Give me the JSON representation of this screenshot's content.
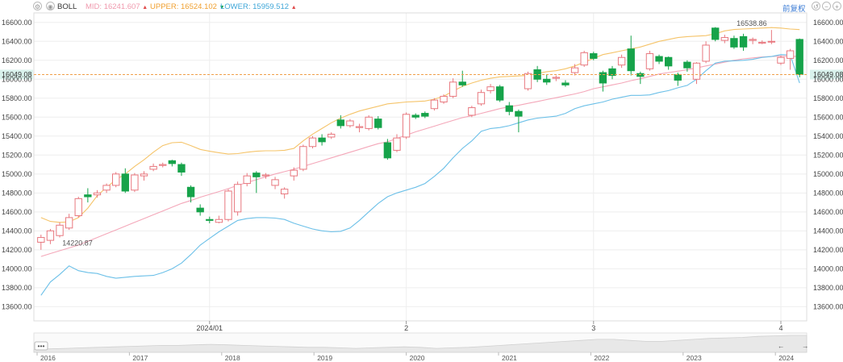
{
  "toolbar": {
    "indicator_name": "BOLL",
    "mid_label": "MID:",
    "mid_value": "16241.607",
    "mid_arrow": "▲",
    "upper_label": "UPPER:",
    "upper_value": "16524.102",
    "upper_arrow": "▼",
    "lower_label": "LOWER:",
    "lower_value": "15959.512",
    "lower_arrow": "▲",
    "adjust_label": "前复权"
  },
  "colors": {
    "mid": "#f4a7b9",
    "upper": "#f5c46a",
    "lower": "#6cc0e8",
    "up_candle": "#e8787f",
    "down_candle": "#16a34a",
    "current_price": "#f0a04b",
    "current_price_tag": "#d9f2ec"
  },
  "icons": [
    "gear-icon",
    "eye-icon",
    "undo-icon",
    "minus-icon",
    "plus-icon",
    "reset-icon"
  ],
  "chart_data": {
    "type": "candlestick",
    "indicator": "BOLL",
    "ylim": [
      13450,
      16700
    ],
    "yticks": [
      13600,
      13800,
      14000,
      14200,
      14400,
      14600,
      14800,
      15000,
      15200,
      15400,
      15600,
      15800,
      16000,
      16200,
      16400,
      16600
    ],
    "ytick_labels": [
      "13600.00",
      "13800.00",
      "14000.00",
      "14200.00",
      "14400.00",
      "14600.00",
      "14800.00",
      "15000.00",
      "15200.00",
      "15400.00",
      "15600.00",
      "15800.00",
      "16000.00",
      "16200.00",
      "16400.00",
      "16600.00"
    ],
    "xtick_labels": [
      {
        "label": "2024/01",
        "index": 18
      },
      {
        "label": "2",
        "index": 39
      },
      {
        "label": "3",
        "index": 59
      },
      {
        "label": "4",
        "index": 79
      }
    ],
    "current_price": 16049.08,
    "current_price_label": "16049.08",
    "annotations": [
      {
        "text": "16538.86",
        "index": 74,
        "value": 16538.86
      },
      {
        "text": "14220.87",
        "index": 2,
        "value": 14220.87
      }
    ],
    "candles": [
      [
        14280,
        14330,
        14200,
        14360
      ],
      [
        14300,
        14400,
        14260,
        14420
      ],
      [
        14350,
        14460,
        14330,
        14490
      ],
      [
        14430,
        14540,
        14410,
        14580
      ],
      [
        14560,
        14740,
        14540,
        14760
      ],
      [
        14780,
        14760,
        14700,
        14850
      ],
      [
        14780,
        14800,
        14750,
        14830
      ],
      [
        14830,
        14880,
        14800,
        14900
      ],
      [
        14880,
        15000,
        14860,
        15020
      ],
      [
        15000,
        14820,
        14800,
        15060
      ],
      [
        14830,
        14990,
        14810,
        15010
      ],
      [
        14980,
        15000,
        14930,
        15030
      ],
      [
        15050,
        15080,
        15030,
        15110
      ],
      [
        15090,
        15100,
        15070,
        15120
      ],
      [
        15140,
        15110,
        15080,
        15150
      ],
      [
        15100,
        15020,
        14980,
        15120
      ],
      [
        14860,
        14760,
        14700,
        14880
      ],
      [
        14640,
        14600,
        14560,
        14680
      ],
      [
        14520,
        14510,
        14480,
        14550
      ],
      [
        14490,
        14520,
        14480,
        14560
      ],
      [
        14520,
        14820,
        14500,
        14840
      ],
      [
        14600,
        14890,
        14560,
        14920
      ],
      [
        14900,
        14980,
        14870,
        15010
      ],
      [
        15010,
        14970,
        14800,
        15030
      ],
      [
        14980,
        14990,
        14950,
        15010
      ],
      [
        14880,
        14940,
        14840,
        14970
      ],
      [
        14790,
        14840,
        14740,
        14860
      ],
      [
        14980,
        15040,
        14930,
        15070
      ],
      [
        15050,
        15290,
        15030,
        15310
      ],
      [
        15290,
        15380,
        15270,
        15400
      ],
      [
        15380,
        15340,
        15300,
        15420
      ],
      [
        15390,
        15420,
        15370,
        15440
      ],
      [
        15570,
        15510,
        15480,
        15620
      ],
      [
        15510,
        15560,
        15490,
        15580
      ],
      [
        15490,
        15500,
        15440,
        15530
      ],
      [
        15480,
        15600,
        15460,
        15620
      ],
      [
        15580,
        15490,
        15470,
        15610
      ],
      [
        15330,
        15170,
        15150,
        15370
      ],
      [
        15250,
        15380,
        15230,
        15420
      ],
      [
        15390,
        15630,
        15370,
        15650
      ],
      [
        15620,
        15600,
        15580,
        15640
      ],
      [
        15640,
        15610,
        15590,
        15660
      ],
      [
        15690,
        15780,
        15670,
        15800
      ],
      [
        15760,
        15820,
        15740,
        15840
      ],
      [
        15820,
        15970,
        15800,
        16010
      ],
      [
        15970,
        15940,
        15920,
        16090
      ],
      [
        15620,
        15700,
        15600,
        15720
      ],
      [
        15740,
        15860,
        15720,
        15890
      ],
      [
        15880,
        15920,
        15850,
        15950
      ],
      [
        15920,
        15780,
        15760,
        15940
      ],
      [
        15720,
        15660,
        15620,
        15760
      ],
      [
        15660,
        15610,
        15440,
        15680
      ],
      [
        15900,
        16060,
        15880,
        16080
      ],
      [
        16100,
        16000,
        15970,
        16140
      ],
      [
        16000,
        15970,
        15940,
        16050
      ],
      [
        16010,
        16020,
        15980,
        16040
      ],
      [
        15960,
        15940,
        15920,
        15990
      ],
      [
        16070,
        16120,
        16040,
        16160
      ],
      [
        16150,
        16280,
        16130,
        16300
      ],
      [
        16270,
        16220,
        16200,
        16290
      ],
      [
        16070,
        15960,
        15870,
        16090
      ],
      [
        16110,
        16040,
        16000,
        16140
      ],
      [
        16150,
        16230,
        16120,
        16260
      ],
      [
        16320,
        16090,
        16040,
        16460
      ],
      [
        16060,
        16030,
        15950,
        16080
      ],
      [
        16110,
        16270,
        16090,
        16300
      ],
      [
        16240,
        16190,
        16160,
        16260
      ],
      [
        16230,
        16140,
        16100,
        16240
      ],
      [
        16050,
        15990,
        15930,
        16070
      ],
      [
        16180,
        16120,
        16080,
        16200
      ],
      [
        16000,
        16170,
        15950,
        16180
      ],
      [
        16190,
        16360,
        16170,
        16400
      ],
      [
        16540,
        16420,
        16400,
        16550
      ],
      [
        16410,
        16440,
        16380,
        16470
      ],
      [
        16430,
        16340,
        16320,
        16460
      ],
      [
        16450,
        16340,
        16300,
        16480
      ],
      [
        16410,
        16420,
        16370,
        16440
      ],
      [
        16380,
        16390,
        16370,
        16410
      ],
      [
        16400,
        16400,
        16370,
        16520
      ],
      [
        16170,
        16230,
        16150,
        16250
      ],
      [
        16220,
        16300,
        16100,
        16320
      ],
      [
        16420,
        16050,
        16020,
        16430
      ]
    ],
    "boll_upper": [
      14540,
      14500,
      14490,
      14495,
      14540,
      14640,
      14770,
      14860,
      14940,
      15000,
      15080,
      15150,
      15230,
      15300,
      15330,
      15335,
      15300,
      15260,
      15240,
      15225,
      15210,
      15215,
      15230,
      15240,
      15245,
      15245,
      15250,
      15270,
      15350,
      15420,
      15480,
      15540,
      15590,
      15630,
      15665,
      15690,
      15715,
      15740,
      15750,
      15760,
      15765,
      15770,
      15790,
      15820,
      15875,
      15925,
      15960,
      15990,
      16010,
      16025,
      16030,
      16035,
      16040,
      16060,
      16080,
      16090,
      16110,
      16140,
      16180,
      16220,
      16260,
      16280,
      16300,
      16320,
      16340,
      16370,
      16400,
      16420,
      16440,
      16450,
      16455,
      16460,
      16480,
      16510,
      16525,
      16530,
      16535,
      16540,
      16545,
      16540,
      16530,
      16524
    ],
    "boll_mid": [
      14130,
      14160,
      14190,
      14220,
      14250,
      14290,
      14330,
      14370,
      14410,
      14450,
      14490,
      14530,
      14570,
      14610,
      14650,
      14690,
      14720,
      14755,
      14785,
      14815,
      14845,
      14880,
      14910,
      14940,
      14970,
      15000,
      15025,
      15050,
      15080,
      15110,
      15140,
      15170,
      15200,
      15230,
      15260,
      15290,
      15320,
      15340,
      15375,
      15410,
      15445,
      15475,
      15505,
      15535,
      15565,
      15595,
      15615,
      15640,
      15665,
      15690,
      15710,
      15725,
      15745,
      15765,
      15785,
      15805,
      15825,
      15845,
      15870,
      15900,
      15920,
      15940,
      15960,
      15985,
      16005,
      16030,
      16055,
      16070,
      16085,
      16100,
      16120,
      16140,
      16160,
      16180,
      16200,
      16215,
      16225,
      16235,
      16240,
      16245,
      16240,
      16242
    ],
    "boll_lower": [
      13720,
      13860,
      13940,
      14030,
      13980,
      13960,
      13950,
      13920,
      13900,
      13910,
      13920,
      13925,
      13930,
      13960,
      14000,
      14060,
      14150,
      14250,
      14320,
      14390,
      14450,
      14510,
      14530,
      14540,
      14540,
      14535,
      14520,
      14480,
      14450,
      14420,
      14400,
      14390,
      14395,
      14430,
      14510,
      14600,
      14690,
      14760,
      14800,
      14830,
      14860,
      14900,
      14975,
      15060,
      15170,
      15270,
      15350,
      15450,
      15480,
      15490,
      15510,
      15540,
      15570,
      15590,
      15600,
      15610,
      15640,
      15690,
      15720,
      15740,
      15760,
      15790,
      15810,
      15830,
      15830,
      15835,
      15860,
      15880,
      15910,
      15935,
      16000,
      16090,
      16170,
      16190,
      16195,
      16200,
      16210,
      16230,
      16240,
      16260,
      16255,
      15960
    ]
  },
  "navigator": {
    "year_labels": [
      "2016",
      "2017",
      "2018",
      "2019",
      "2020",
      "2021",
      "2022",
      "2023",
      "2024"
    ],
    "series": [
      3,
      3.5,
      4,
      4.5,
      5,
      5.5,
      6,
      6.5,
      7,
      7,
      7.5,
      8,
      7.5,
      7,
      6.5,
      6,
      5.5,
      5,
      5,
      4.5,
      4,
      4.5,
      5,
      5.5,
      5,
      4,
      4.5,
      5,
      6,
      7,
      8,
      9,
      10,
      11,
      12,
      13,
      13,
      12,
      11,
      11,
      12,
      13,
      14,
      14.5,
      15,
      16,
      16.5,
      17,
      17
    ],
    "ellipsis": "•••",
    "back_arrow": "←",
    "fwd_arrow": "→"
  }
}
